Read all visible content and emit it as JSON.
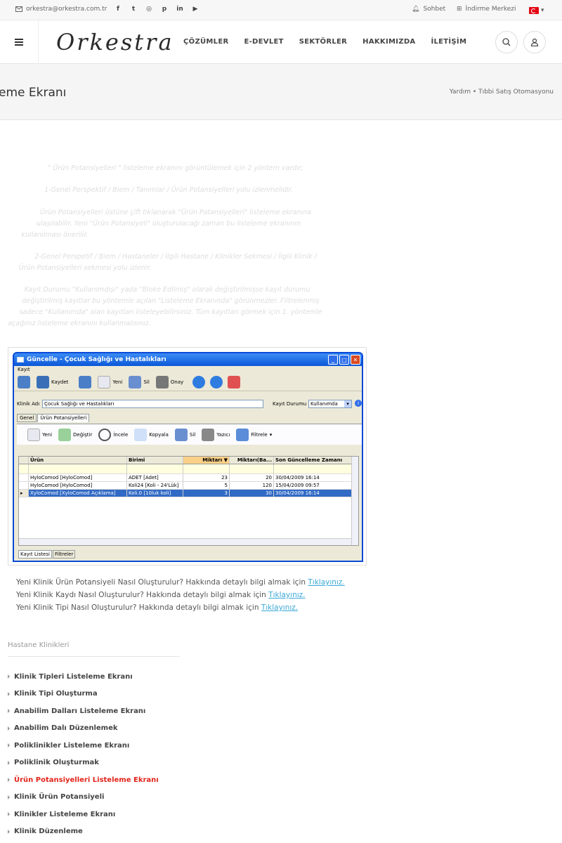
{
  "topbar": {
    "email": "orkestra@orkestra.com.tr",
    "chat": "Sohbet",
    "download": "İndirme Merkezi"
  },
  "nav": {
    "logo": "Orkestra",
    "items": [
      "ÇÖZÜMLER",
      "E-DEVLET",
      "SEKTÖRLER",
      "HAKKIMIZDA",
      "İLETİŞİM"
    ]
  },
  "title": {
    "heading": "eme Ekranı",
    "breadcrumb": "Yardım • Tıbbi Satış Otomasyonu"
  },
  "content": {
    "p1": "\" Ürün Potansiyelleri \" listeleme ekranını görüntülemek için 2 yöntem vardır;",
    "p2": "1-Genel Perspektif / Biem / Tanımlar / Ürün Potansiyelleri yolu izlenmelidir.",
    "p3a": "Ürün Potansiyelleri üstüne çift tıklanarak \"Ürün Potansiyelleri\" listeleme ekranına",
    "p3b": "ulaşılabilir. Yeni \"Ürün Potansiyeli\" oluşturulacağı zaman bu listeleme ekranının",
    "p3c": "kullanılması önerilir.",
    "p4a": "2-Genel Perspetif / Biem / Hastaneler / İlgili Hastane / Klinikler Sekmesi / İlgili Klinik /",
    "p4b": "Ürün Potansiyelleri sekmesi yolu izlenir.",
    "p5a": "Kayıt Durumu \"Kullanımdışı\" yada \"Bloke Edilmiş\" olarak değiştirilmişse kayıt durumu",
    "p5b": "değiştirilmiş kayıtlar bu yöntemle açılan \"Listeleme Ekranında\" görünmezler. Filtrelenmiş",
    "p5c": "sadece \"Kullanımda\" olan kayıtları listeleyebilirsiniz. Tüm kayıtları görmek için 1. yöntemle",
    "p5d": "açağınız listeleme ekranını kullanmalısınız."
  },
  "window": {
    "title": "Güncelle - Çocuk Sağlığı ve Hastalıkları",
    "menu": "Kayıt",
    "toolbar": [
      "Kaydet",
      "Yeni",
      "Sil",
      "Onay"
    ],
    "clinic_label": "Klinik Adı",
    "clinic_value": "Çocuk Sağlığı ve Hastalıkları",
    "status_label": "Kayıt Durumu",
    "status_value": "Kullanımda",
    "tabs": [
      "Genel",
      "Ürün Potansiyelleri"
    ],
    "subtoolbar": [
      "Yeni",
      "Değiştir",
      "İncele",
      "Kopyala",
      "Sil",
      "Yazıcı",
      "Filtrele"
    ],
    "columns": [
      "Ürün",
      "Birimi",
      "Miktarı",
      "Miktarı(Ba...",
      "Son Güncelleme Zamanı"
    ],
    "rows": [
      [
        "HyloComod [HyloComod]",
        "ADET [Adet]",
        "23",
        "20",
        "30/04/2009 16:14"
      ],
      [
        "HyloComod [HyloComod]",
        "Koli24 [Koli - 24'Lük]",
        "5",
        "120",
        "15/04/2009 09:57"
      ],
      [
        "XyloComod [XyloComod Açıklama]",
        "Koli.0 [10luk koli]",
        "3",
        "30",
        "30/04/2009 16:14"
      ]
    ],
    "bottom_tabs": [
      "Kayıt Listesi",
      "Filtreler"
    ]
  },
  "links": [
    {
      "text": "Yeni Klinik Ürün Potansiyeli Nasıl Oluşturulur? Hakkında detaylı bilgi almak için ",
      "link": "Tıklayınız."
    },
    {
      "text": "Yeni Klinik Kaydı Nasıl Oluşturulur? Hakkında detaylı bilgi almak için ",
      "link": "Tıklayınız."
    },
    {
      "text": "Yeni Klinik Tipi Nasıl Oluşturulur? Hakkında detaylı bilgi almak için ",
      "link": "Tıklayınız."
    }
  ],
  "sidebar": {
    "heading": "Hastane Klinikleri",
    "items": [
      "Klinik Tipleri Listeleme Ekranı",
      "Klinik Tipi Oluşturma",
      "Anabilim Dalları Listeleme Ekranı",
      "Anabilim Dalı Düzenlemek",
      "Poliklinikler Listeleme Ekranı",
      "Poliklinik Oluşturmak",
      "Ürün Potansiyelleri Listeleme Ekranı",
      "Klinik Ürün Potansiyeli",
      "Klinikler Listeleme Ekranı",
      "Klinik Düzenleme"
    ]
  }
}
